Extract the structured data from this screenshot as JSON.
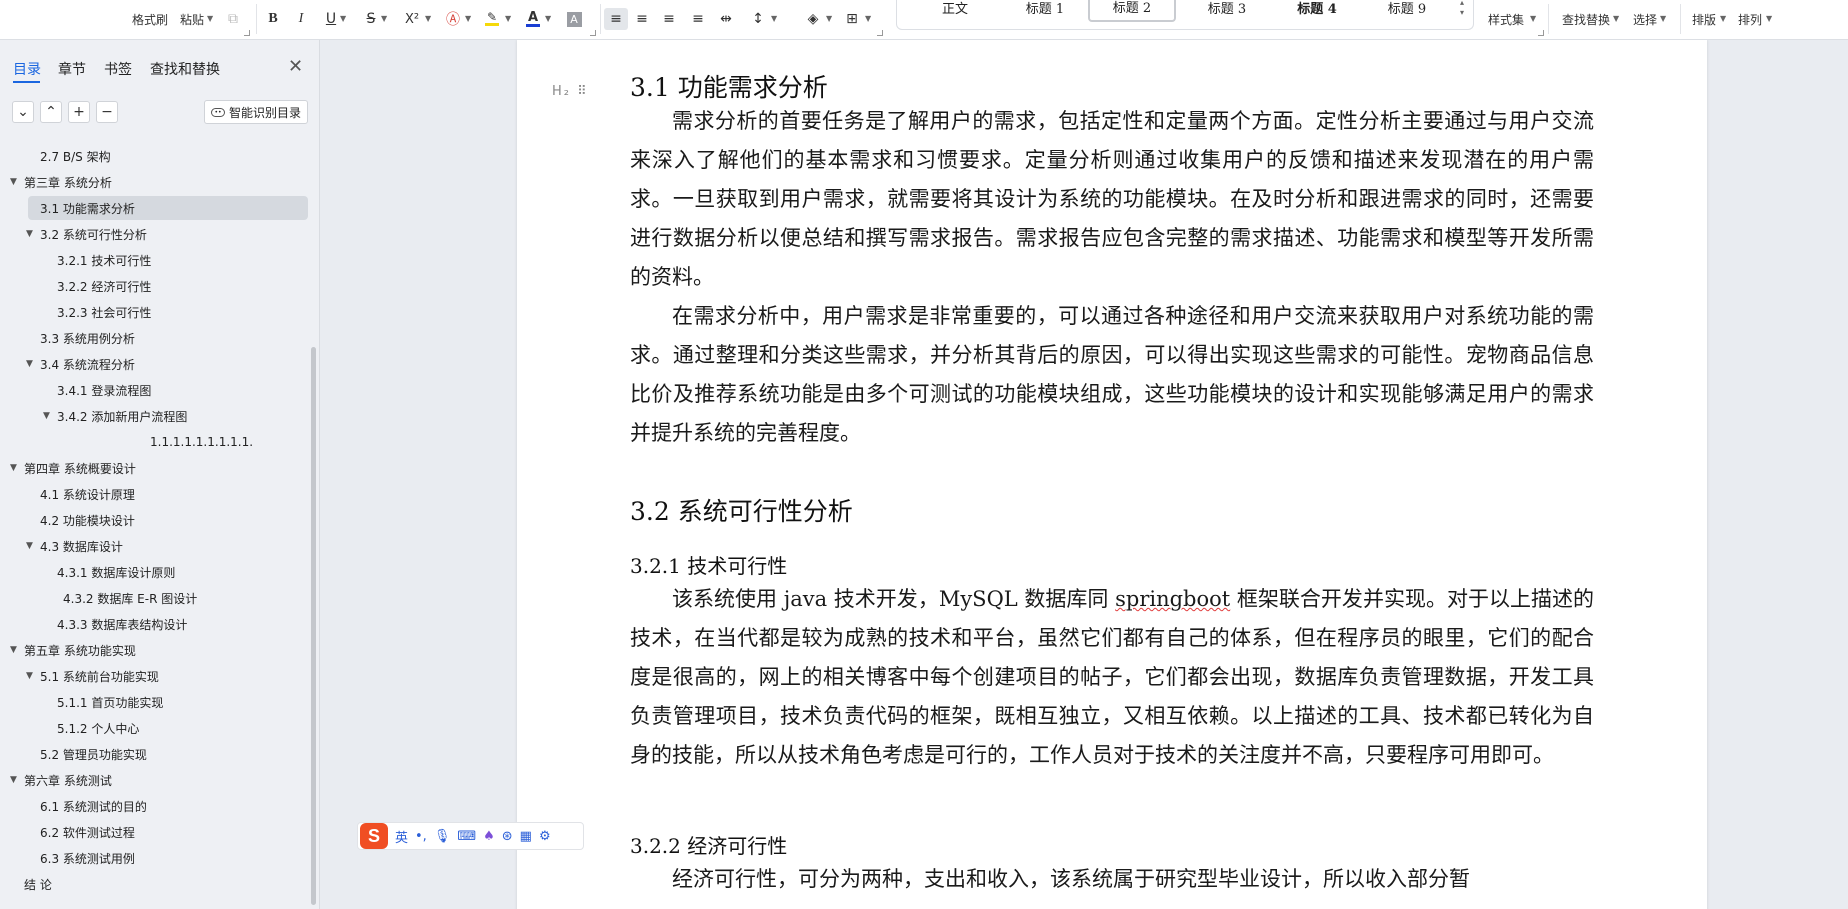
{
  "ribbon": {
    "format_painter": "格式刷",
    "paste": "粘贴",
    "bold": "B",
    "italic": "I",
    "underline": "U",
    "strikethrough": "S",
    "superscript": "X²",
    "font_color_glyph": "A",
    "char_shading": "A",
    "styles": [
      "正文",
      "标题 1",
      "标题 2",
      "标题 3",
      "标题 4",
      "标题 9"
    ],
    "styles_set": "样式集",
    "find_replace": "查找替换",
    "select": "选择",
    "layout": "排版",
    "arrange": "排列",
    "highlight_color": "#f5d90a",
    "font_color": "#1a3fd4"
  },
  "sidebar": {
    "tabs": [
      "目录",
      "章节",
      "书签",
      "查找和替换"
    ],
    "smart_toc": "智能识别目录",
    "toc": [
      {
        "label": "2.7 B/S 架构",
        "level": 2,
        "arrow": ""
      },
      {
        "label": "第三章 系统分析",
        "level": 1,
        "arrow": "▼"
      },
      {
        "label": "3.1 功能需求分析",
        "level": 2,
        "arrow": "",
        "selected": true
      },
      {
        "label": "3.2 系统可行性分析",
        "level": 2,
        "arrow": "▼"
      },
      {
        "label": "3.2.1 技术可行性",
        "level": 3,
        "arrow": ""
      },
      {
        "label": "3.2.2  经济可行性",
        "level": 3,
        "arrow": ""
      },
      {
        "label": "3.2.3 社会可行性",
        "level": 3,
        "arrow": ""
      },
      {
        "label": "3.3  系统用例分析",
        "level": 2,
        "arrow": ""
      },
      {
        "label": "3.4 系统流程分析",
        "level": 2,
        "arrow": "▼"
      },
      {
        "label": "3.4.1  登录流程图",
        "level": 3,
        "arrow": ""
      },
      {
        "label": "3.4.2  添加新用户流程图",
        "level": 3,
        "arrow": "▼"
      },
      {
        "label": "1.1.1.1.1.1.1.1.1.",
        "level": 5,
        "arrow": ""
      },
      {
        "label": "第四章  系统概要设计",
        "level": 1,
        "arrow": "▼"
      },
      {
        "label": "4.1 系统设计原理",
        "level": 2,
        "arrow": ""
      },
      {
        "label": "4.2 功能模块设计",
        "level": 2,
        "arrow": ""
      },
      {
        "label": "4.3  数据库设计",
        "level": 2,
        "arrow": "▼"
      },
      {
        "label": "4.3.1 数据库设计原则",
        "level": 3,
        "arrow": ""
      },
      {
        "label": "4.3.2 数据库 E-R 图设计",
        "level": 3,
        "arrow": "",
        "extra_indent": true
      },
      {
        "label": "4.3.3 数据库表结构设计",
        "level": 3,
        "arrow": ""
      },
      {
        "label": "第五章  系统功能实现",
        "level": 1,
        "arrow": "▼"
      },
      {
        "label": "5.1 系统前台功能实现",
        "level": 2,
        "arrow": "▼"
      },
      {
        "label": "5.1.1 首页功能实现",
        "level": 3,
        "arrow": ""
      },
      {
        "label": "5.1.2 个人中心",
        "level": 3,
        "arrow": ""
      },
      {
        "label": "5.2 管理员功能实现",
        "level": 2,
        "arrow": ""
      },
      {
        "label": "第六章  系统测试",
        "level": 1,
        "arrow": "▼"
      },
      {
        "label": "6.1 系统测试的目的",
        "level": 2,
        "arrow": ""
      },
      {
        "label": "6.2 软件测试过程",
        "level": 2,
        "arrow": ""
      },
      {
        "label": "6.3 系统测试用例",
        "level": 2,
        "arrow": ""
      },
      {
        "label": "结  论",
        "level": 1,
        "arrow": ""
      }
    ]
  },
  "document": {
    "heading_marker": "H₂ ⠿",
    "h_3_1": "3.1 功能需求分析",
    "p1": "需求分析的首要任务是了解用户的需求，包括定性和定量两个方面。定性分析主要通过与用户交流来深入了解他们的基本需求和习惯要求。定量分析则通过收集用户的反馈和描述来发现潜在的用户需求。一旦获取到用户需求，就需要将其设计为系统的功能模块。在及时分析和跟进需求的同时，还需要进行数据分析以便总结和撰写需求报告。需求报告应包含完整的需求描述、功能需求和模型等开发所需的资料。",
    "p2": "在需求分析中，用户需求是非常重要的，可以通过各种途径和用户交流来获取用户对系统功能的需求。通过整理和分类这些需求，并分析其背后的原因，可以得出实现这些需求的可能性。宠物商品信息比价及推荐系统功能是由多个可测试的功能模块组成，这些功能模块的设计和实现能够满足用户的需求并提升系统的完善程度。",
    "h_3_2": "3.2 系统可行性分析",
    "h_3_2_1": "3.2.1 技术可行性",
    "p3_a": "该系统使用 java 技术开发，MySQL 数据库同 ",
    "p3_spell": "springboot",
    "p3_b": " 框架联合开发并实现。对于以上描述的技术，在当代都是较为成熟的技术和平台，虽然它们都有自己的体系，但在程序员的眼里，它们的配合度是很高的，网上的相关博客中每个创建项目的帖子，它们都会出现，数据库负责管理数据，开发工具负责管理项目，技术负责代码的框架，既相互独立，又相互依赖。以上描述的工具、技术都已转化为自身的技能，所以从技术角色考虑是可行的，工作人员对于技术的关注度并不高，只要程序可用即可。",
    "h_3_2_2": "3.2.2  经济可行性",
    "p4": "经济可行性，可分为两种，支出和收入，该系统属于研究型毕业设计，所以收入部分暂"
  },
  "ime": {
    "lang": "英",
    "punct": "•,",
    "icons": [
      "mic-icon",
      "keyboard-icon",
      "skin-icon",
      "game-icon",
      "apps-icon",
      "settings-icon"
    ]
  }
}
